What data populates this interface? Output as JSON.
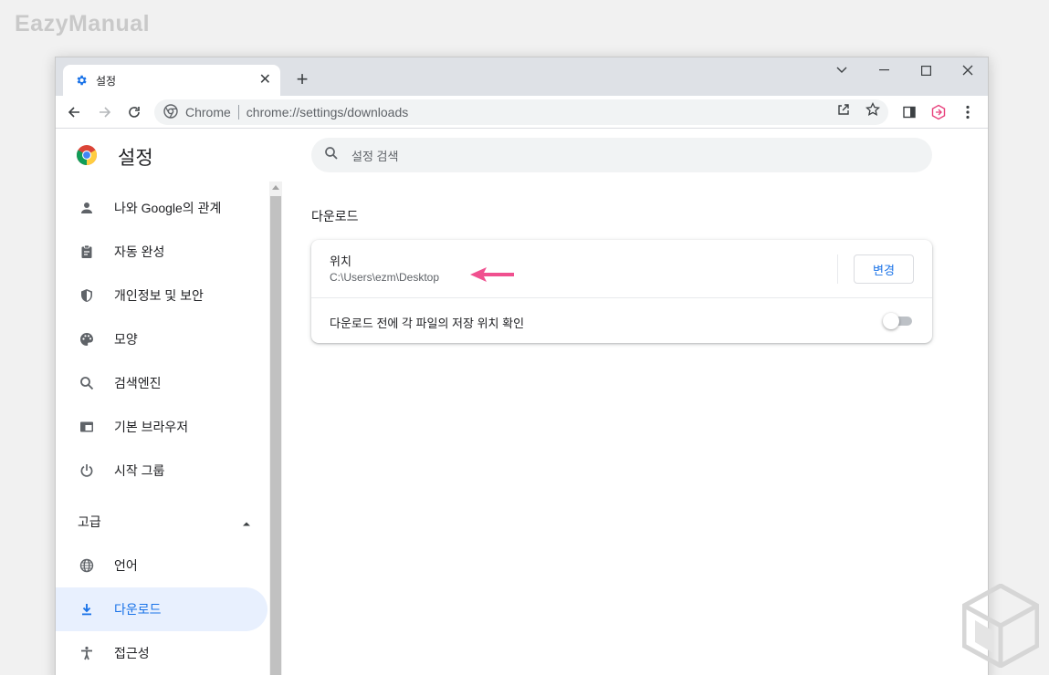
{
  "watermark": {
    "text": "EazyManual"
  },
  "tab": {
    "title": "설정",
    "icon": "gear-icon"
  },
  "window_controls": [
    "chevron-down-icon",
    "minimize-icon",
    "maximize-icon",
    "close-icon"
  ],
  "omnibox": {
    "site_label": "Chrome",
    "url": "chrome://settings/downloads"
  },
  "sidebar": {
    "title": "설정",
    "items": [
      {
        "label": "나와 Google의 관계",
        "icon": "person-icon"
      },
      {
        "label": "자동 완성",
        "icon": "clipboard-icon"
      },
      {
        "label": "개인정보 및 보안",
        "icon": "shield-icon"
      },
      {
        "label": "모양",
        "icon": "palette-icon"
      },
      {
        "label": "검색엔진",
        "icon": "search-icon"
      },
      {
        "label": "기본 브라우저",
        "icon": "browser-icon"
      },
      {
        "label": "시작 그룹",
        "icon": "power-icon"
      }
    ],
    "advanced": {
      "label": "고급"
    },
    "advanced_items": [
      {
        "label": "언어",
        "icon": "globe-icon"
      },
      {
        "label": "다운로드",
        "icon": "download-icon",
        "active": true
      },
      {
        "label": "접근성",
        "icon": "accessibility-icon"
      }
    ]
  },
  "search": {
    "placeholder": "설정 검색"
  },
  "downloads": {
    "section_title": "다운로드",
    "location_label": "위치",
    "location_path": "C:\\Users\\ezm\\Desktop",
    "change_button": "변경",
    "ask_label": "다운로드 전에 각 파일의 저장 위치 확인",
    "ask_enabled": false
  },
  "colors": {
    "accent": "#1a73e8",
    "active_bg": "#e8f0fe",
    "annotation_arrow": "#f0508f"
  }
}
